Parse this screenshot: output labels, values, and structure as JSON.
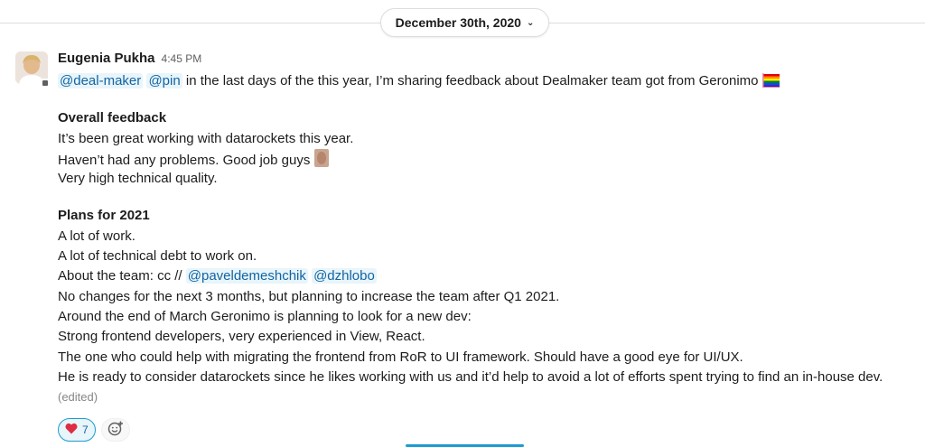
{
  "date_divider": {
    "label": "December 30th, 2020"
  },
  "message": {
    "author": "Eugenia Pukha",
    "time": "4:45 PM",
    "intro": {
      "mention_1": "@deal-maker",
      "mention_2": "@pin",
      "text": " in the last days of the this year, I’m sharing feedback about Dealmaker team got from Geronimo "
    },
    "section_1": {
      "heading": "Overall feedback",
      "line_1": "It’s been great working with datarockets this year.",
      "line_2": "Haven’t had any problems. Good job guys ",
      "line_3": "Very high technical quality."
    },
    "section_2": {
      "heading": "Plans for 2021",
      "line_1": "A lot of work.",
      "line_2": "A lot of technical debt to work on.",
      "team_prefix": "About the team:  cc // ",
      "team_mention_1": "@paveldemeshchik",
      "team_mention_2": "@dzhlobo",
      "line_4": "No changes for the next 3 months, but planning to increase the team after Q1 2021.",
      "line_5": "Around the end of March Geronimo is planning to look for a new dev:",
      "line_6": "Strong frontend developers, very experienced in View, React.",
      "line_7": "The one who could help with migrating the frontend from RoR to UI framework. Should have a good eye for UI/UX.",
      "line_8": "He is ready to consider datarockets since he likes working with us and it’d help to avoid a lot of efforts spent trying to find an in-house dev.",
      "edited": "(edited)"
    },
    "reactions": [
      {
        "emoji": "heart",
        "count": "7"
      }
    ]
  },
  "colors": {
    "mention_text": "#1264a3",
    "mention_bg": "#e8f5fa",
    "reaction_border": "#1d9bd1",
    "muted": "#616061"
  }
}
